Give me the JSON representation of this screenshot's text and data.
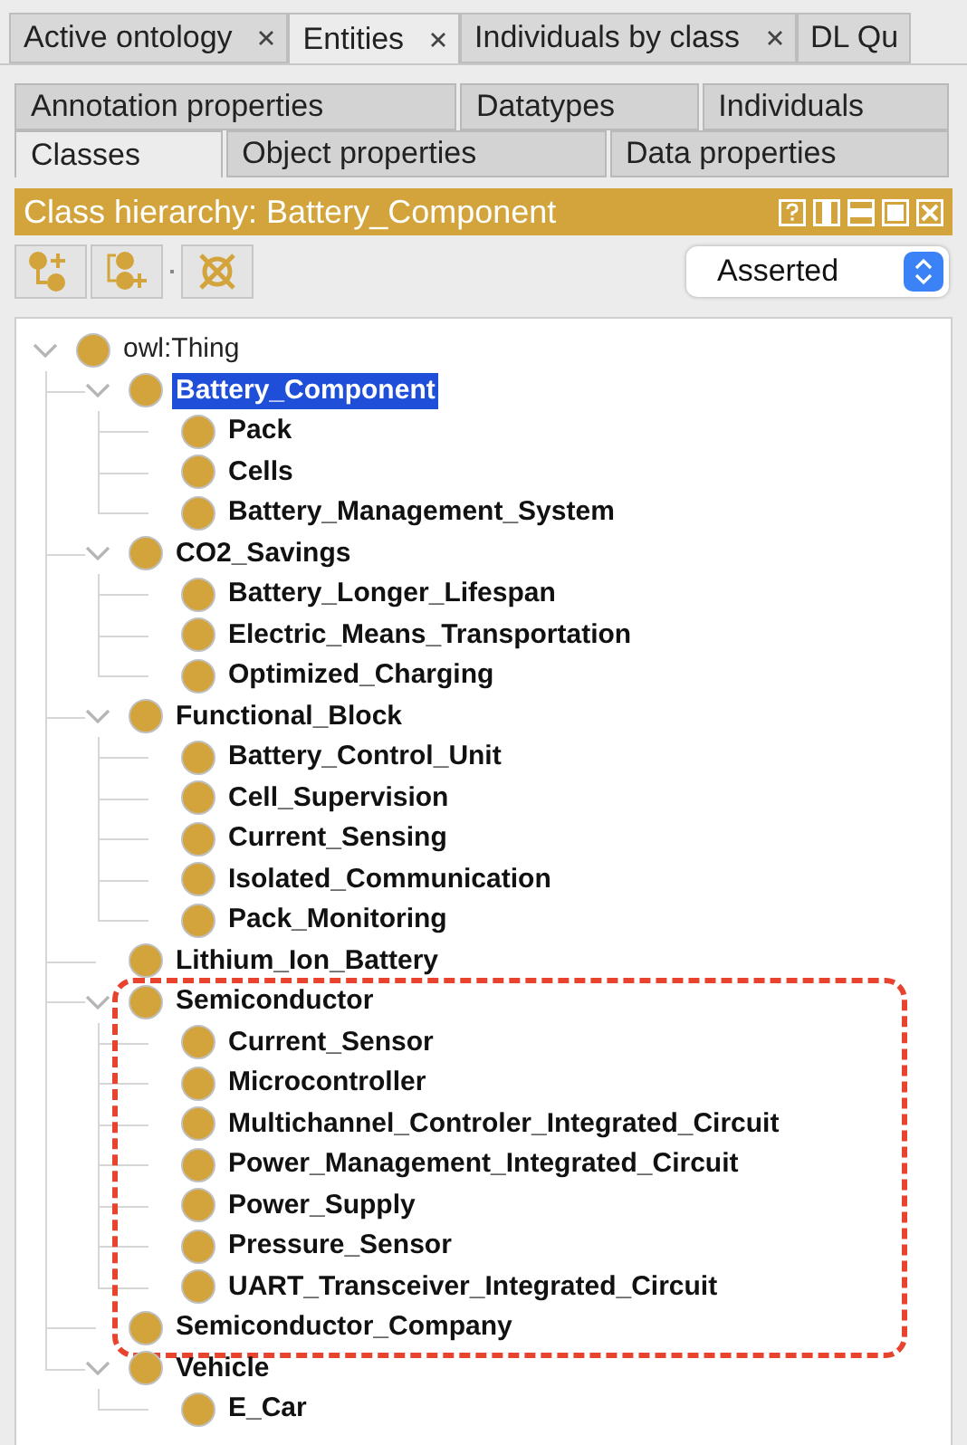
{
  "workspace_tabs": [
    {
      "label": "Active ontology",
      "selected": false,
      "closable": true
    },
    {
      "label": "Entities",
      "selected": true,
      "closable": true
    },
    {
      "label": "Individuals by class",
      "selected": false,
      "closable": true
    },
    {
      "label": "DL Qu",
      "selected": false,
      "closable": false
    }
  ],
  "entity_tabs": [
    [
      {
        "label": "Annotation properties",
        "selected": false
      },
      {
        "label": "Datatypes",
        "selected": false
      },
      {
        "label": "Individuals",
        "selected": false
      }
    ],
    [
      {
        "label": "Classes",
        "selected": true
      },
      {
        "label": "Object properties",
        "selected": false
      },
      {
        "label": "Data properties",
        "selected": false
      }
    ]
  ],
  "view": {
    "title": "Class hierarchy: Battery_Component",
    "mode": "Asserted"
  },
  "tree": [
    {
      "label": "owl:Thing",
      "selected": false,
      "expanded": true,
      "highlighted": false,
      "children": [
        {
          "label": "Battery_Component",
          "selected": true,
          "expanded": true,
          "highlighted": false,
          "children": [
            {
              "label": "Pack",
              "selected": false,
              "expanded": false,
              "highlighted": false
            },
            {
              "label": "Cells",
              "selected": false,
              "expanded": false,
              "highlighted": false
            },
            {
              "label": "Battery_Management_System",
              "selected": false,
              "expanded": false,
              "highlighted": false
            }
          ]
        },
        {
          "label": "CO2_Savings",
          "selected": false,
          "expanded": true,
          "highlighted": false,
          "children": [
            {
              "label": "Battery_Longer_Lifespan",
              "selected": false,
              "expanded": false,
              "highlighted": false
            },
            {
              "label": "Electric_Means_Transportation",
              "selected": false,
              "expanded": false,
              "highlighted": false
            },
            {
              "label": "Optimized_Charging",
              "selected": false,
              "expanded": false,
              "highlighted": false
            }
          ]
        },
        {
          "label": "Functional_Block",
          "selected": false,
          "expanded": true,
          "highlighted": false,
          "children": [
            {
              "label": "Battery_Control_Unit",
              "selected": false,
              "expanded": false,
              "highlighted": false
            },
            {
              "label": "Cell_Supervision",
              "selected": false,
              "expanded": false,
              "highlighted": false
            },
            {
              "label": "Current_Sensing",
              "selected": false,
              "expanded": false,
              "highlighted": false
            },
            {
              "label": "Isolated_Communication",
              "selected": false,
              "expanded": false,
              "highlighted": false
            },
            {
              "label": "Pack_Monitoring",
              "selected": false,
              "expanded": false,
              "highlighted": false
            }
          ]
        },
        {
          "label": "Lithium_Ion_Battery",
          "selected": false,
          "expanded": false,
          "highlighted": false
        },
        {
          "label": "Semiconductor",
          "selected": false,
          "expanded": true,
          "highlighted": true,
          "children": [
            {
              "label": "Current_Sensor",
              "selected": false,
              "expanded": false,
              "highlighted": false
            },
            {
              "label": "Microcontroller",
              "selected": false,
              "expanded": false,
              "highlighted": false
            },
            {
              "label": "Multichannel_Controler_Integrated_Circuit",
              "selected": false,
              "expanded": false,
              "highlighted": false
            },
            {
              "label": "Power_Management_Integrated_Circuit",
              "selected": false,
              "expanded": false,
              "highlighted": false
            },
            {
              "label": "Power_Supply",
              "selected": false,
              "expanded": false,
              "highlighted": false
            },
            {
              "label": "Pressure_Sensor",
              "selected": false,
              "expanded": false,
              "highlighted": false
            },
            {
              "label": "UART_Transceiver_Integrated_Circuit",
              "selected": false,
              "expanded": false,
              "highlighted": false
            }
          ]
        },
        {
          "label": "Semiconductor_Company",
          "selected": false,
          "expanded": false,
          "highlighted": true
        },
        {
          "label": "Vehicle",
          "selected": false,
          "expanded": true,
          "highlighted": false,
          "children": [
            {
              "label": "E_Car",
              "selected": false,
              "expanded": false,
              "highlighted": false
            }
          ]
        }
      ]
    }
  ]
}
